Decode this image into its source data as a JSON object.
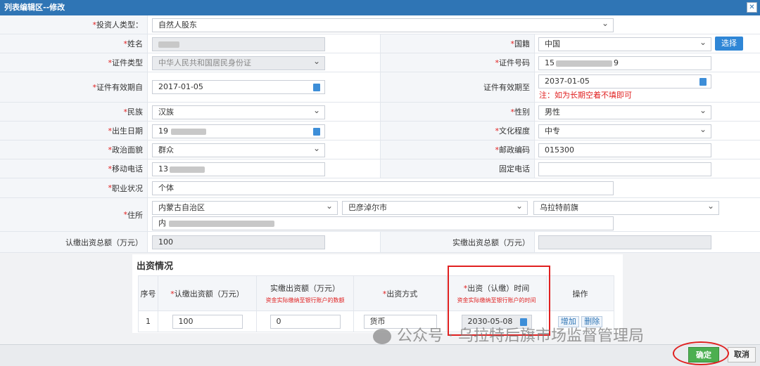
{
  "window": {
    "title": "列表编辑区--修改",
    "close_icon": "✕"
  },
  "form": {
    "investor_type": {
      "label": "投资人类型：",
      "value": "自然人股东"
    },
    "name": {
      "label": "姓名",
      "value": ""
    },
    "nationality": {
      "label": "国籍",
      "value": "中国",
      "choose_label": "选择"
    },
    "id_type": {
      "label": "证件类型",
      "value": "中华人民共和国居民身份证"
    },
    "id_number": {
      "label": "证件号码",
      "value_start": "15",
      "value_end": "9"
    },
    "id_valid_from": {
      "label": "证件有效期自",
      "value": "2017-01-05"
    },
    "id_valid_to": {
      "label": "证件有效期至",
      "value": "2037-01-05",
      "note": "注：如为长期空着不填即可"
    },
    "ethnicity": {
      "label": "民族",
      "value": "汉族"
    },
    "gender": {
      "label": "性别",
      "value": "男性"
    },
    "birth_date": {
      "label": "出生日期",
      "value": "19"
    },
    "education": {
      "label": "文化程度",
      "value": "中专"
    },
    "political_status": {
      "label": "政治面貌",
      "value": "群众"
    },
    "postcode": {
      "label": "邮政编码",
      "value": "015300"
    },
    "mobile": {
      "label": "移动电话",
      "value": "13"
    },
    "landline": {
      "label": "固定电话",
      "value": ""
    },
    "occupation": {
      "label": "职业状况",
      "value": "个体"
    },
    "residence": {
      "label": "住所",
      "province": "内蒙古自治区",
      "city": "巴彦淖尔市",
      "county": "乌拉特前旗",
      "detail": "内"
    },
    "subscribed_amount": {
      "label": "认缴出资总额（万元）",
      "value": "100"
    },
    "paid_amount": {
      "label": "实缴出资总额（万元）",
      "value": ""
    }
  },
  "investment": {
    "title": "出资情况",
    "headers": {
      "seq": "序号",
      "subscribed": "认缴出资额（万元）",
      "paid": "实缴出资额（万元）",
      "paid_note": "资金实际缴纳至银行账户的数额",
      "method": "出资方式",
      "time": "出资（认缴）时间",
      "time_note": "资金实际缴纳至银行账户的时间",
      "ops": "操作"
    },
    "row": {
      "seq": "1",
      "subscribed": "100",
      "paid": "0",
      "method": "货币",
      "time": "2030-05-08",
      "add": "增加",
      "delete": "删除"
    }
  },
  "footer": {
    "ok": "确定",
    "cancel": "取消"
  },
  "watermark": {
    "text": "公众号 · 乌拉特后旗市场监督管理局",
    "icon": "wechat-icon"
  },
  "colors": {
    "titlebar": "#2f75b5",
    "required": "#e02020",
    "ok_button": "#4caf50",
    "annotation": "#e02020"
  }
}
